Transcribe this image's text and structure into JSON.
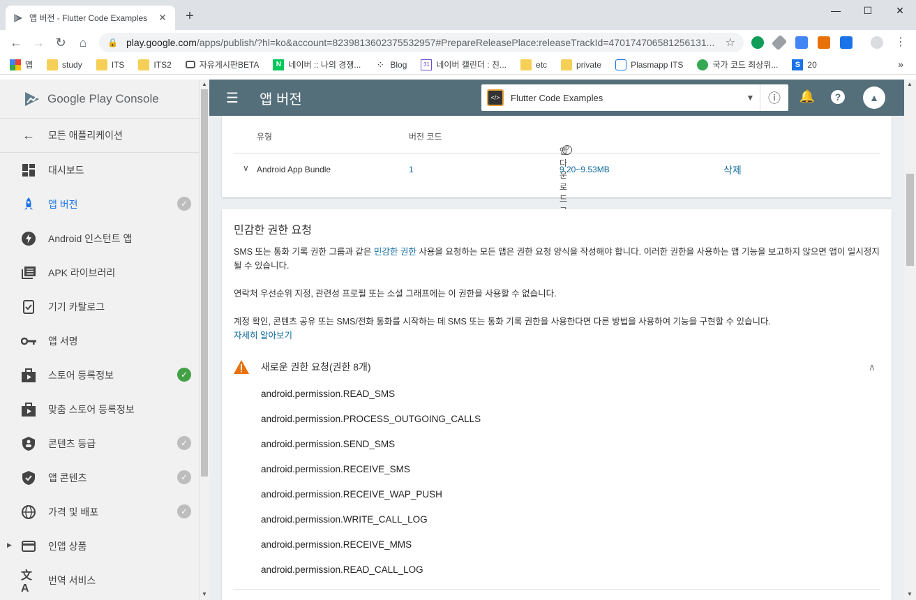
{
  "browser": {
    "tab_title": "앱 버전 - Flutter Code Examples",
    "url_host": "play.google.com",
    "url_path": "/apps/publish/?hl=ko&account=8239813602375532957#PrepareReleasePlace:releaseTrackId=470174706581256131...",
    "new_tab": "+",
    "bookmarks": [
      "앱",
      "study",
      "ITS",
      "ITS2",
      "자유게시판BETA",
      "네이버 :: 나의 경쟁...",
      "Blog",
      "네이버 캘린더 : 친...",
      "etc",
      "private",
      "Plasmapp ITS",
      "국가 코드 최상위...",
      "20"
    ],
    "bookmark_more": "»"
  },
  "sidebar": {
    "brand": "Google Play Console",
    "back_label": "모든 애플리케이션",
    "items": [
      {
        "label": "대시보드"
      },
      {
        "label": "앱 버전"
      },
      {
        "label": "Android 인스턴트 앱"
      },
      {
        "label": "APK 라이브러리"
      },
      {
        "label": "기기 카탈로그"
      },
      {
        "label": "앱 서명"
      },
      {
        "label": "스토어 등록정보"
      },
      {
        "label": "맞춤 스토어 등록정보"
      },
      {
        "label": "콘텐츠 등급"
      },
      {
        "label": "앱 콘텐츠"
      },
      {
        "label": "가격 및 배포"
      },
      {
        "label": "인앱 상품"
      },
      {
        "label": "번역 서비스"
      }
    ]
  },
  "appbar": {
    "title": "앱 버전",
    "app_name": "Flutter Code Examples"
  },
  "bundle_table": {
    "headers": {
      "type": "유형",
      "code": "버전 코드",
      "size": "앱 다운로드 크기"
    },
    "row": {
      "type": "Android App Bundle",
      "code": "1",
      "size": "9.20~9.53MB",
      "delete": "삭제"
    }
  },
  "permissions_card": {
    "title": "민감한 권한 요청",
    "p1_before": "SMS 또는 통화 기록 권한 그룹과 같은 ",
    "p1_link": "민감한 권한",
    "p1_after": " 사용을 요청하는 모든 앱은 권한 요청 양식을 작성해야 합니다. 이러한 권한을 사용하는 앱 기능을 보고하지 않으면 앱이 일시정지될 수 있습니다.",
    "p2": "연락처 우선순위 지정, 관련성 프로필 또는 소셜 그래프에는 이 권한을 사용할 수 없습니다.",
    "p3": "계정 확인, 콘텐츠 공유 또는 SMS/전화 통화를 시작하는 데 SMS 또는 통화 기록 권한을 사용한다면 다른 방법을 사용하여 기능을 구현할 수 있습니다.",
    "learn_more": "자세히 알아보기",
    "new_requests_title": "새로운 권한 요청(권한 8개)",
    "permissions": [
      "android.permission.READ_SMS",
      "android.permission.PROCESS_OUTGOING_CALLS",
      "android.permission.SEND_SMS",
      "android.permission.RECEIVE_SMS",
      "android.permission.RECEIVE_WAP_PUSH",
      "android.permission.WRITE_CALL_LOG",
      "android.permission.RECEIVE_MMS",
      "android.permission.READ_CALL_LOG"
    ]
  },
  "colors": {
    "appbar": "#546e7a",
    "link": "#0f6b9e",
    "active": "#1a73e8",
    "warning": "#e8710a",
    "check_done": "#43a047"
  }
}
